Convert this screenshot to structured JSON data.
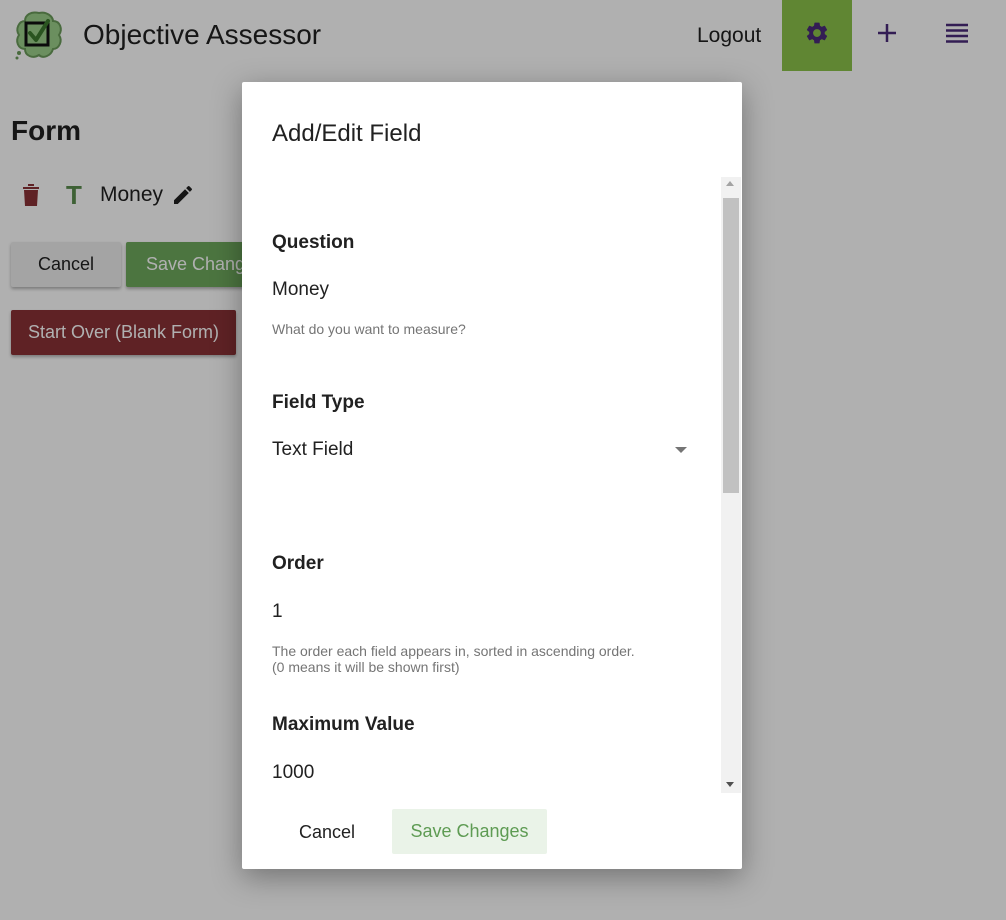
{
  "header": {
    "app_title": "Objective Assessor",
    "logout_label": "Logout",
    "settings_icon": "gear-icon",
    "add_icon": "plus-icon",
    "menu_icon": "list-icon",
    "accent_color": "#8bc34a",
    "brand_purple": "#4a2a7a"
  },
  "page": {
    "title": "Form",
    "field": {
      "type_glyph": "T",
      "name": "Money"
    },
    "cancel_label": "Cancel",
    "save_label": "Save Changes",
    "start_over_label": "Start Over (Blank Form)"
  },
  "dialog": {
    "title": "Add/Edit Field",
    "question": {
      "label": "Question",
      "value": "Money",
      "help": "What do you want to measure?"
    },
    "field_type": {
      "label": "Field Type",
      "selected": "Text Field"
    },
    "order": {
      "label": "Order",
      "value": "1",
      "help_line1": "The order each field appears in, sorted in ascending order.",
      "help_line2": "(0 means it will be shown first)"
    },
    "maximum_value": {
      "label": "Maximum Value",
      "value": "1000"
    },
    "cancel_label": "Cancel",
    "save_label": "Save Changes"
  }
}
